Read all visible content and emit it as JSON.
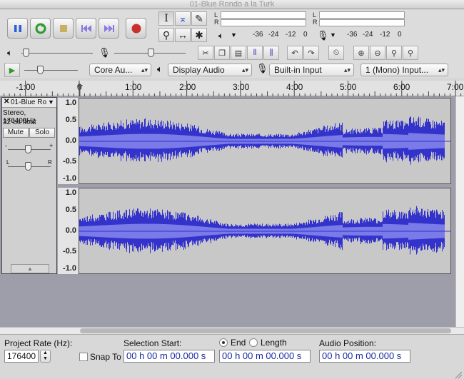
{
  "window": {
    "title": "01-Blue Rondo a la Turk"
  },
  "transport": {
    "pause": "pause-icon",
    "play": "play-icon",
    "stop": "stop-icon",
    "skip_start": "skip-start-icon",
    "skip_end": "skip-end-icon",
    "record": "record-icon"
  },
  "tools": [
    "I",
    "⌅",
    "✎",
    "⚲",
    "↔",
    "✱"
  ],
  "meters": {
    "play_label_l": "L",
    "play_label_r": "R",
    "rec_label_l": "L",
    "rec_label_r": "R",
    "ticks": [
      "-36",
      "-24",
      "-12",
      "0"
    ]
  },
  "device_toolbar": {
    "host": "Core Au...",
    "output": "Display Audio",
    "input": "Built-in Input",
    "channels": "1 (Mono) Input..."
  },
  "ruler": {
    "labels": [
      "-1:00",
      "0",
      "1:00",
      "2:00",
      "3:00",
      "4:00",
      "5:00",
      "6:00",
      "7:00"
    ]
  },
  "track": {
    "name": "01-Blue Ro",
    "format": "Stereo, 176400Hz",
    "bitdepth": "32-bit float",
    "mute": "Mute",
    "solo": "Solo",
    "pan_left": "L",
    "pan_right": "R",
    "scale": [
      "1.0",
      "0.5",
      "0.0",
      "-0.5",
      "-1.0"
    ],
    "waveform_color": "#3333cc",
    "waveform_rms_color": "#7a7ae8"
  },
  "bottom": {
    "project_rate_label": "Project Rate (Hz):",
    "project_rate": "176400",
    "snap_to": "Snap To",
    "selection_start_label": "Selection Start:",
    "end_label": "End",
    "length_label": "Length",
    "audio_position_label": "Audio Position:",
    "time_value": "00 h 00 m 00.000 s"
  }
}
